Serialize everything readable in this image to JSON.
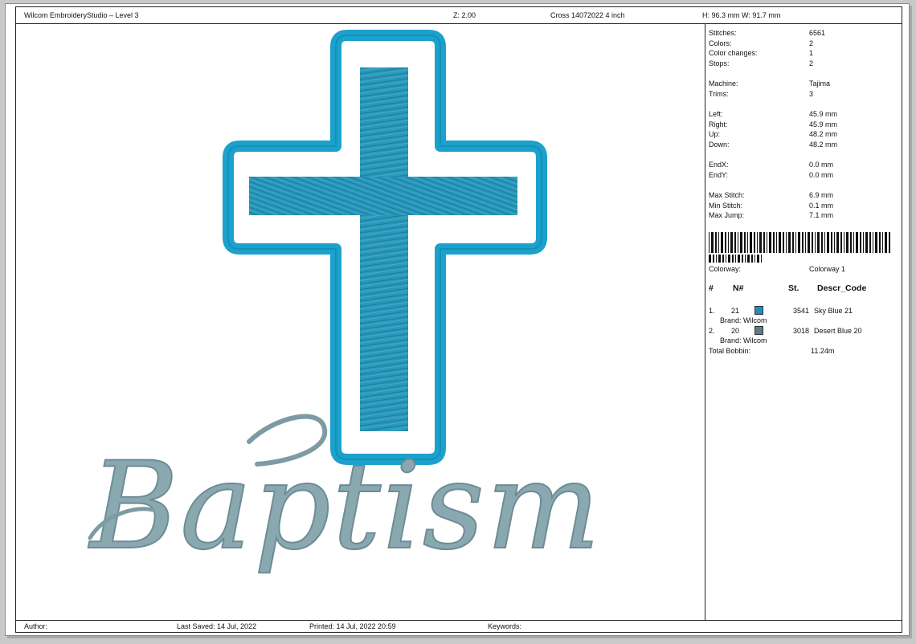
{
  "header": {
    "app": "Wilcom EmbroideryStudio – Level 3",
    "zoom": "Z: 2.00",
    "design_name": "Cross 14072022 4 inch",
    "size": "H: 96.3 mm  W: 91.7 mm"
  },
  "design": {
    "text": "Baptism",
    "cross_color": "#1a9cc4",
    "text_color": "#7c9ba4"
  },
  "stats": [
    {
      "label": "Stitches:",
      "value": "6561"
    },
    {
      "label": "Colors:",
      "value": "2"
    },
    {
      "label": "Color changes:",
      "value": "1"
    },
    {
      "label": "Stops:",
      "value": "2"
    },
    {
      "label": "Machine:",
      "value": "Tajima"
    },
    {
      "label": "Trims:",
      "value": "3"
    },
    {
      "label": "Left:",
      "value": "45.9 mm"
    },
    {
      "label": "Right:",
      "value": "45.9 mm"
    },
    {
      "label": "Up:",
      "value": "48.2 mm"
    },
    {
      "label": "Down:",
      "value": "48.2 mm"
    },
    {
      "label": "EndX:",
      "value": "0.0 mm"
    },
    {
      "label": "EndY:",
      "value": "0.0 mm"
    },
    {
      "label": "Max Stitch:",
      "value": "6.9 mm"
    },
    {
      "label": "Min Stitch:",
      "value": "0.1 mm"
    },
    {
      "label": "Max Jump:",
      "value": "7.1 mm"
    }
  ],
  "colorway": {
    "label": "Colorway:",
    "value": "Colorway 1"
  },
  "table": {
    "headers": [
      "#",
      "N#",
      "St.",
      "Descr_Code"
    ],
    "rows": [
      {
        "idx": "1.",
        "n": "21",
        "st": "3541",
        "desc": "Sky Blue 21",
        "brand": "Brand: Wilcom",
        "color": "#1a8fc0"
      },
      {
        "idx": "2.",
        "n": "20",
        "st": "3018",
        "desc": "Desert Blue 20",
        "brand": "Brand: Wilcom",
        "color": "#5d7c89"
      }
    ],
    "total_label": "Total Bobbin:",
    "total_value": "11.24m"
  },
  "footer": {
    "author": "Author:",
    "last_saved": "Last Saved: 14 Jul, 2022",
    "printed": "Printed: 14 Jul, 2022 20:59",
    "keywords": "Keywords:"
  }
}
